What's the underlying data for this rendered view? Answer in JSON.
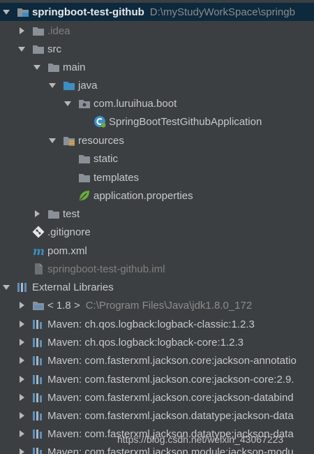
{
  "project": {
    "name": "springboot-test-github",
    "path": "D:\\myStudyWorkSpace\\springb"
  },
  "nodes": {
    "idea": ".idea",
    "src": "src",
    "main": "main",
    "java": "java",
    "package": "com.luruihua.boot",
    "app_class": "SpringBootTestGithubApplication",
    "resources": "resources",
    "static": "static",
    "templates": "templates",
    "app_props": "application.properties",
    "test": "test",
    "gitignore": ".gitignore",
    "pom": "pom.xml",
    "iml": "springboot-test-github.iml"
  },
  "libraries": {
    "title": "External Libraries",
    "jdk_label": "< 1.8 >",
    "jdk_path": "C:\\Program Files\\Java\\jdk1.8.0_172",
    "items": [
      "Maven: ch.qos.logback:logback-classic:1.2.3",
      "Maven: ch.qos.logback:logback-core:1.2.3",
      "Maven: com.fasterxml.jackson.core:jackson-annotatio",
      "Maven: com.fasterxml.jackson.core:jackson-core:2.9.",
      "Maven: com.fasterxml.jackson.core:jackson-databind",
      "Maven: com.fasterxml.jackson.datatype:jackson-data",
      "Maven: com.fasterxml.jackson.datatype:jackson-data",
      "Maven: com.fasterxml.jackson.module:jackson-modu"
    ]
  },
  "watermark": "https://blog.csdn.net/weixin_43067223",
  "colors": {
    "background": "#3c3f41",
    "selection": "#0d293e",
    "folder": "#8a9097",
    "java_folder": "#3b8fc4",
    "maven_bars": "#5d8fbe"
  }
}
